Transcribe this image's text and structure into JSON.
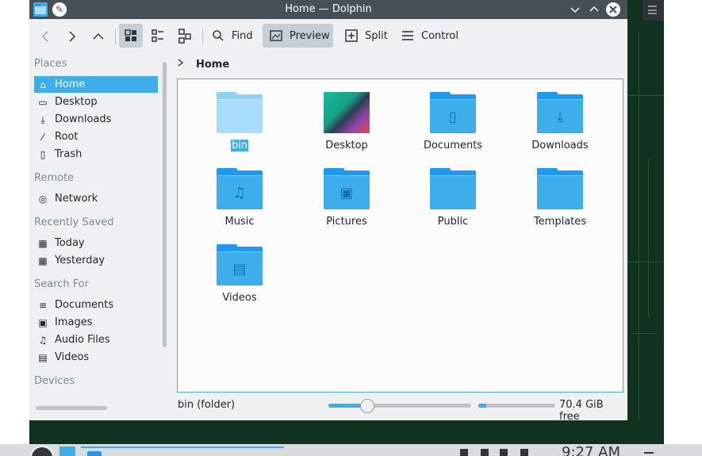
{
  "window": {
    "title": "Home — Dolphin"
  },
  "toolbar": {
    "find_label": "Find",
    "preview_label": "Preview",
    "split_label": "Split",
    "control_label": "Control"
  },
  "places": {
    "sections": [
      {
        "header": "Places",
        "items": [
          {
            "label": "Home",
            "icon": "home-icon",
            "selected": true
          },
          {
            "label": "Desktop",
            "icon": "desktop-icon"
          },
          {
            "label": "Downloads",
            "icon": "download-icon"
          },
          {
            "label": "Root",
            "icon": "root-icon"
          },
          {
            "label": "Trash",
            "icon": "trash-icon"
          }
        ]
      },
      {
        "header": "Remote",
        "items": [
          {
            "label": "Network",
            "icon": "network-icon"
          }
        ]
      },
      {
        "header": "Recently Saved",
        "items": [
          {
            "label": "Today",
            "icon": "calendar-icon"
          },
          {
            "label": "Yesterday",
            "icon": "calendar-icon"
          }
        ]
      },
      {
        "header": "Search For",
        "items": [
          {
            "label": "Documents",
            "icon": "document-icon"
          },
          {
            "label": "Images",
            "icon": "image-icon"
          },
          {
            "label": "Audio Files",
            "icon": "audio-icon"
          },
          {
            "label": "Videos",
            "icon": "video-icon"
          }
        ]
      },
      {
        "header": "Devices",
        "items": []
      }
    ]
  },
  "breadcrumb": {
    "current": "Home"
  },
  "files": [
    {
      "name": "bin",
      "type": "folder",
      "emblem": "none",
      "selected": true
    },
    {
      "name": "Desktop",
      "type": "image-preview"
    },
    {
      "name": "Documents",
      "type": "folder",
      "emblem": "document-icon"
    },
    {
      "name": "Downloads",
      "type": "folder",
      "emblem": "download-icon"
    },
    {
      "name": "Music",
      "type": "folder",
      "emblem": "music-icon"
    },
    {
      "name": "Pictures",
      "type": "folder",
      "emblem": "picture-icon"
    },
    {
      "name": "Public",
      "type": "folder",
      "emblem": "none"
    },
    {
      "name": "Templates",
      "type": "folder",
      "emblem": "none"
    },
    {
      "name": "Videos",
      "type": "folder",
      "emblem": "film-icon"
    }
  ],
  "statusbar": {
    "selection_text": "bin (folder)",
    "zoom_level": 0.27,
    "space_used_fraction": 0.1,
    "free_space_text": "70.4 GiB free"
  },
  "taskbar": {
    "clock": "9:27 AM"
  },
  "colors": {
    "accent": "#3daee9",
    "titlebar": "#475057",
    "window_bg": "#eff0f1",
    "desktop_bg": "#10331f"
  }
}
